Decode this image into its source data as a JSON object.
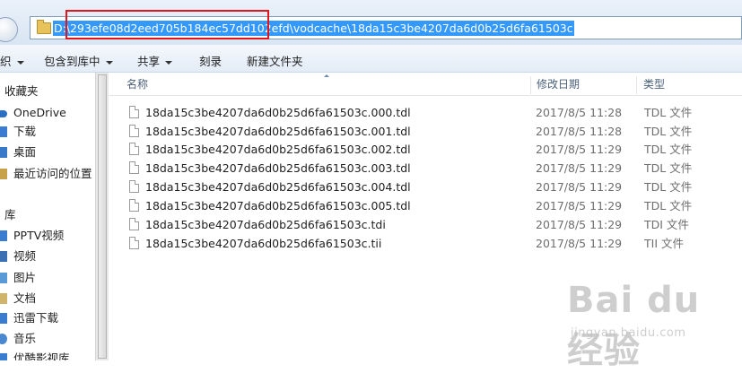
{
  "address_bar": {
    "path": "D:\\293efe08d2eed705b184ec57dd102efd\\vodcache\\18da15c3be4207da6d0b25d6fa61503c"
  },
  "toolbar": {
    "organize_partial": "织",
    "include_in_library": "包含到库中",
    "share": "共享",
    "burn": "刻录",
    "new_folder": "新建文件夹"
  },
  "sidebar": {
    "favorites_header": "收藏夹",
    "favorites": [
      "OneDrive",
      "下载",
      "桌面",
      "最近访问的位置"
    ],
    "libraries_header": "库",
    "libraries": [
      "PPTV视频",
      "视频",
      "图片",
      "文档",
      "迅雷下载",
      "音乐",
      "优酷影视库"
    ]
  },
  "columns": {
    "name": "名称",
    "date_modified": "修改日期",
    "type": "类型"
  },
  "files": [
    {
      "name": "18da15c3be4207da6d0b25d6fa61503c.000.tdl",
      "date": "2017/8/5 11:28",
      "type": "TDL 文件"
    },
    {
      "name": "18da15c3be4207da6d0b25d6fa61503c.001.tdl",
      "date": "2017/8/5 11:28",
      "type": "TDL 文件"
    },
    {
      "name": "18da15c3be4207da6d0b25d6fa61503c.002.tdl",
      "date": "2017/8/5 11:29",
      "type": "TDL 文件"
    },
    {
      "name": "18da15c3be4207da6d0b25d6fa61503c.003.tdl",
      "date": "2017/8/5 11:29",
      "type": "TDL 文件"
    },
    {
      "name": "18da15c3be4207da6d0b25d6fa61503c.004.tdl",
      "date": "2017/8/5 11:29",
      "type": "TDL 文件"
    },
    {
      "name": "18da15c3be4207da6d0b25d6fa61503c.005.tdl",
      "date": "2017/8/5 11:29",
      "type": "TDL 文件"
    },
    {
      "name": "18da15c3be4207da6d0b25d6fa61503c.tdi",
      "date": "2017/8/5 11:29",
      "type": "TDI 文件"
    },
    {
      "name": "18da15c3be4207da6d0b25d6fa61503c.tii",
      "date": "2017/8/5 11:29",
      "type": "TII 文件"
    }
  ],
  "watermark": {
    "logo_text": "Bai du 经验",
    "url": "jingyan.baidu.com"
  },
  "colors": {
    "selection": "#3399ff",
    "highlight_box": "#e0161c",
    "folder": "#e8c25a"
  }
}
